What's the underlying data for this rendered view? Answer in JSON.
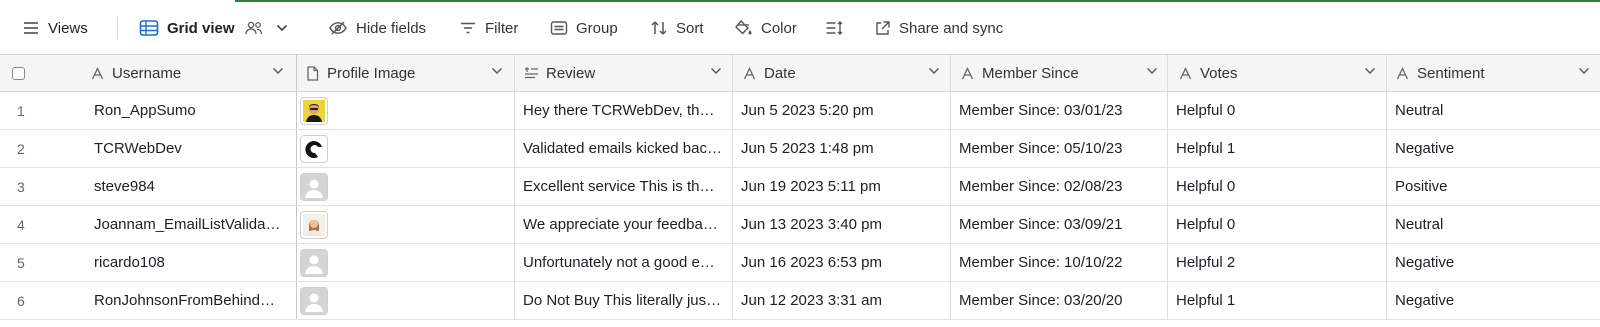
{
  "toolbar": {
    "views_label": "Views",
    "grid_view_label": "Grid view",
    "hide_fields_label": "Hide fields",
    "filter_label": "Filter",
    "group_label": "Group",
    "sort_label": "Sort",
    "color_label": "Color",
    "share_label": "Share and sync"
  },
  "columns": [
    {
      "label": "Username",
      "icon": "text-icon"
    },
    {
      "label": "Profile Image",
      "icon": "file-icon"
    },
    {
      "label": "Review",
      "icon": "long-text-icon"
    },
    {
      "label": "Date",
      "icon": "text-icon"
    },
    {
      "label": "Member Since",
      "icon": "text-icon"
    },
    {
      "label": "Votes",
      "icon": "text-icon"
    },
    {
      "label": "Sentiment",
      "icon": "text-icon"
    }
  ],
  "rows": [
    {
      "num": "1",
      "username": "Ron_AppSumo",
      "image": "avatar-photo-man",
      "review": "Hey there TCRWebDev, thanks for sharing your experience",
      "date": "Jun 5 2023 5:20 pm",
      "member_since": "Member Since: 03/01/23",
      "votes": "Helpful 0",
      "sentiment": "Neutral"
    },
    {
      "num": "2",
      "username": "TCRWebDev",
      "image": "avatar-logo-black",
      "review": "Validated emails kicked back as invalid",
      "date": "Jun 5 2023 1:48 pm",
      "member_since": "Member Since: 05/10/23",
      "votes": "Helpful 1",
      "sentiment": "Negative"
    },
    {
      "num": "3",
      "username": "steve984",
      "image": "avatar-placeholder",
      "review": "Excellent service This is the best validation service",
      "date": "Jun 19 2023 5:11 pm",
      "member_since": "Member Since: 02/08/23",
      "votes": "Helpful 0",
      "sentiment": "Positive"
    },
    {
      "num": "4",
      "username": "Joannam_EmailListValidation",
      "image": "avatar-photo-woman",
      "review": "We appreciate your feedback and thank you",
      "date": "Jun 13 2023 3:40 pm",
      "member_since": "Member Since: 03/09/21",
      "votes": "Helpful 0",
      "sentiment": "Neutral"
    },
    {
      "num": "5",
      "username": "ricardo108",
      "image": "avatar-placeholder",
      "review": "Unfortunately not a good experience",
      "date": "Jun 16 2023 6:53 pm",
      "member_since": "Member Since: 10/10/22",
      "votes": "Helpful 2",
      "sentiment": "Negative"
    },
    {
      "num": "6",
      "username": "RonJohnsonFromBehindTheScenes",
      "image": "avatar-placeholder",
      "review": "Do Not Buy This literally just does not work",
      "date": "Jun 12 2023 3:31 am",
      "member_since": "Member Since: 03/20/20",
      "votes": "Helpful 1",
      "sentiment": "Negative"
    }
  ],
  "colors": {
    "accent": "#1f6fd1",
    "top_line": "#2d7f3a",
    "header_bg": "#f5f5f5"
  }
}
